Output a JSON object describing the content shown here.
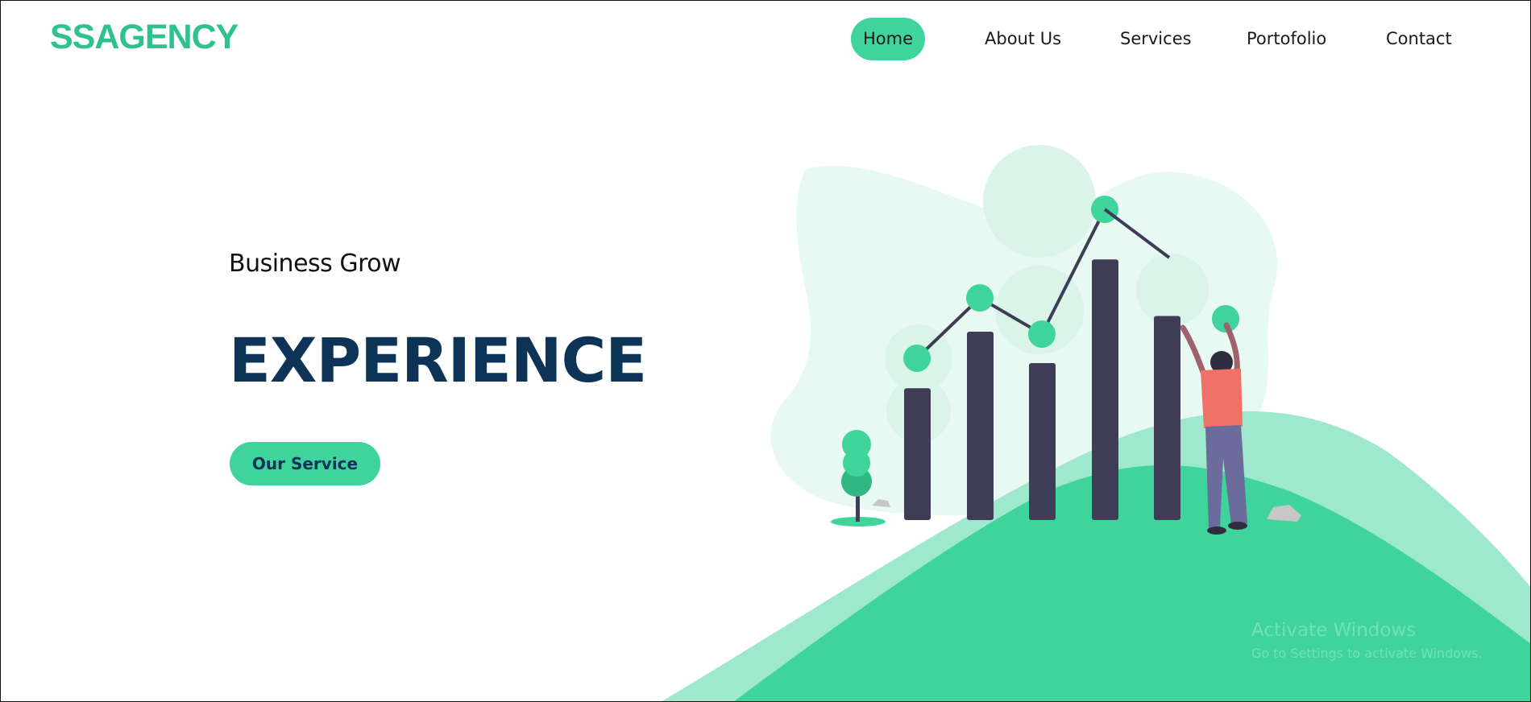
{
  "header": {
    "logo_text": "SSAGENCY",
    "nav": [
      {
        "label": "Home",
        "active": true
      },
      {
        "label": "About Us",
        "active": false
      },
      {
        "label": "Services",
        "active": false
      },
      {
        "label": "Portofolio",
        "active": false
      },
      {
        "label": "Contact",
        "active": false
      }
    ]
  },
  "hero": {
    "subtitle": "Business Grow",
    "title": "EXPERIENCE",
    "cta_label": "Our Service"
  },
  "illustration": {
    "name": "business-growth-illustration",
    "bar_values": [
      0.42,
      0.6,
      0.5,
      0.83,
      0.65
    ],
    "line_points": [
      0.25,
      0.4,
      0.31,
      0.62
    ],
    "colors": {
      "accent": "#3ed49c",
      "hill_light": "#9ee8cd",
      "bar": "#3f3d56",
      "blob": "#e8f8f2",
      "brand": "#2ec28e",
      "title": "#0d3356"
    }
  },
  "watermark": {
    "title": "Activate Windows",
    "subtitle": "Go to Settings to activate Windows."
  }
}
